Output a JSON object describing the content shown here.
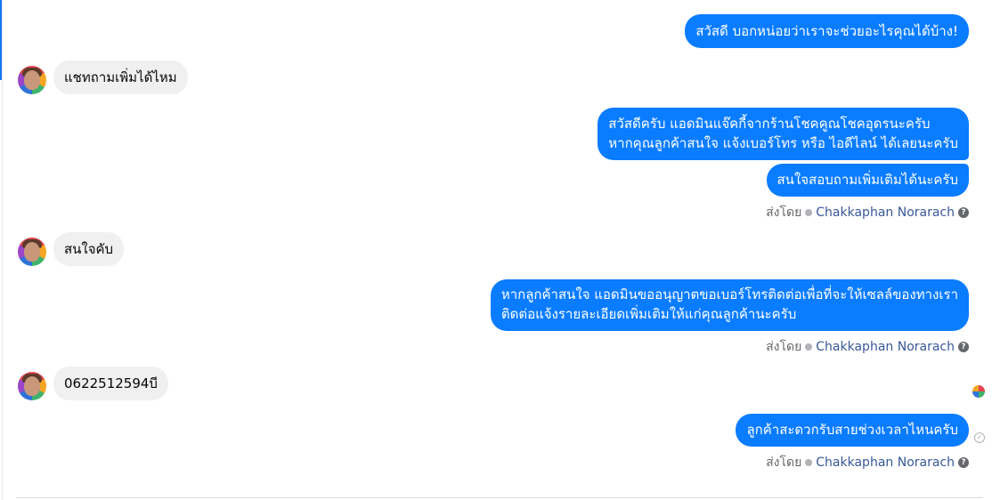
{
  "conversation": {
    "outgoing": {
      "m1": "สวัสดี บอกหน่อยว่าเราจะช่วยอะไรคุณได้บ้าง!",
      "m2_line1": "สวัสดีครับ แอดมินแจ๊คกี้จากร้านโชคคูณโชคอุดรนะครับ",
      "m2_line2": "หากคุณลูกค้าสนใจ แจ้งเบอร์โทร หรือ ไอดีไลน์ ได้เลยนะครับ",
      "m3": "สนใจสอบถามเพิ่มเติมได้นะครับ",
      "m4_line1": "หากลูกค้าสนใจ แอดมินขออนุญาตขอเบอร์โทรติดต่อเพื่อที่จะให้เซลล์ของทางเรา",
      "m4_line2": "ติดต่อแจ้งรายละเอียดเพิ่มเติมให้แก่คุณลูกค้านะครับ",
      "m5": "ลูกค้าสะดวกรับสายช่วงเวลาไหนครับ"
    },
    "incoming": {
      "m1": "แชทถามเพิ่มได้ไหม",
      "m2": "สนใจคับ",
      "m3": "0622512594บี"
    },
    "sent_by": {
      "prefix": "ส่งโดย",
      "name": "Chakkaphan Norarach",
      "help_glyph": "?"
    },
    "icons": {
      "avatar": "user-avatar-icon",
      "check": "verified-check-icon",
      "help": "help-icon",
      "sent_status": "sent-check-icon"
    },
    "colors": {
      "outgoing_bubble": "#0a7cff",
      "incoming_bubble": "#f0f0f0",
      "sender_name": "#385898"
    },
    "sent_status_glyph": "✓"
  }
}
